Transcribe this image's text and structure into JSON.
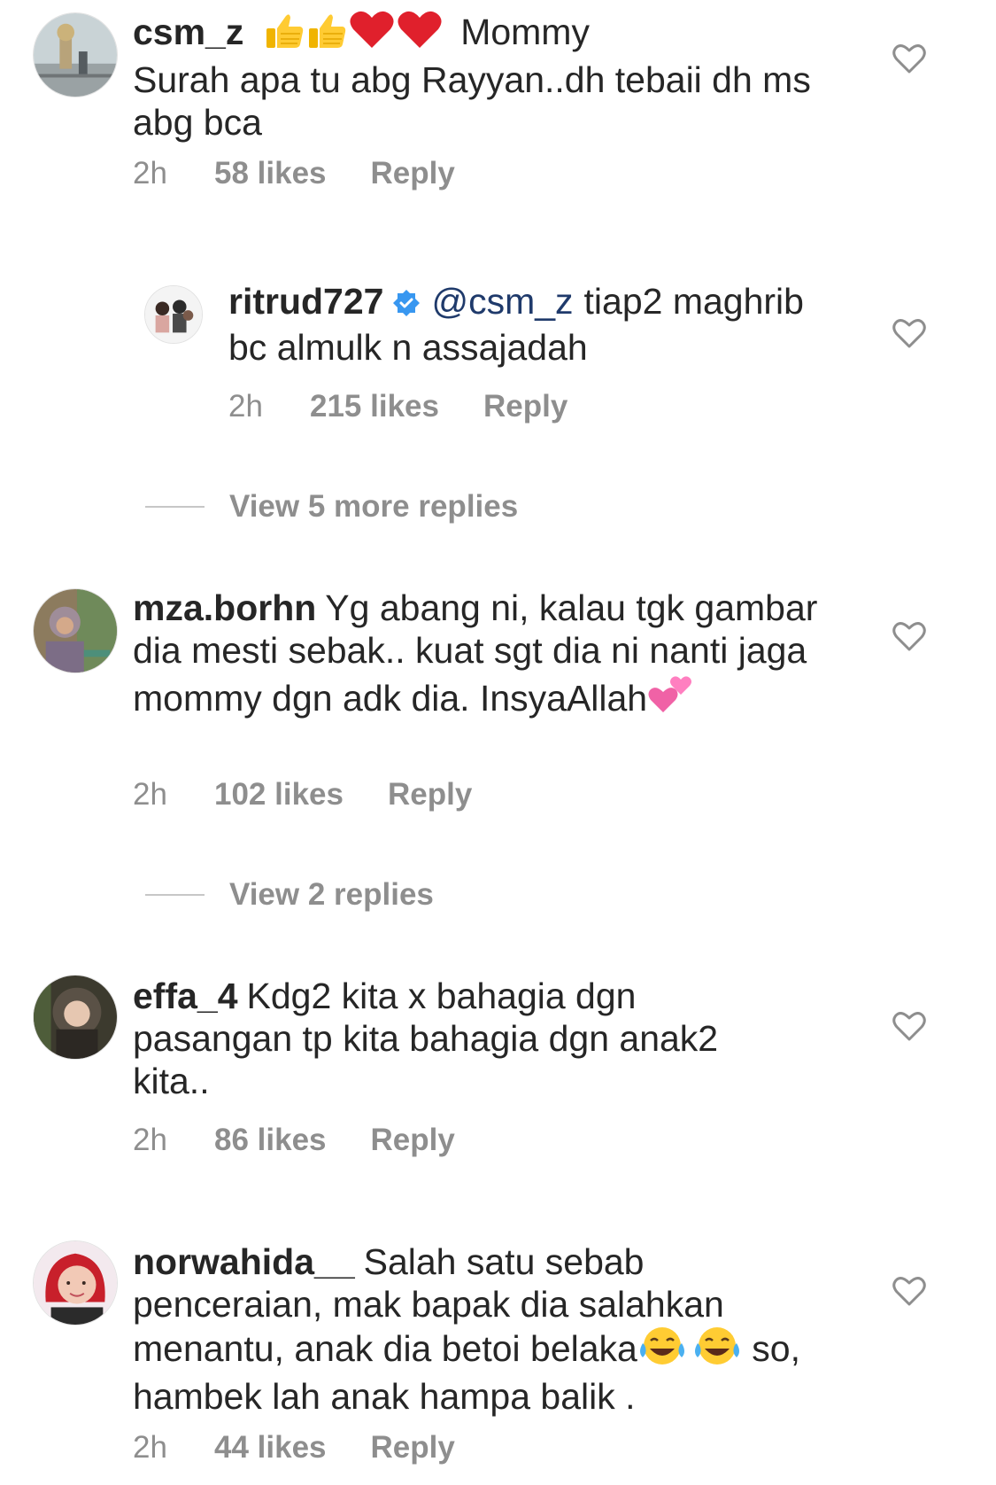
{
  "comments": [
    {
      "username": "csm_z",
      "emoji_prefix": [
        "thumbs-up",
        "thumbs-up",
        "red-heart",
        "red-heart"
      ],
      "text_line1": "Mommy",
      "text_rest": "Surah apa tu abg Rayyan..dh tebaii dh ms abg bca",
      "time": "2h",
      "likes": "58 likes",
      "reply": "Reply"
    },
    {
      "username": "ritrud727",
      "verified": true,
      "mention": "@csm_z",
      "text": "tiap2 maghrib bc almulk n assajadah",
      "time": "2h",
      "likes": "215 likes",
      "reply": "Reply"
    },
    {
      "username": "mza.borhn",
      "text": "Yg abang ni, kalau tgk gambar dia mesti sebak.. kuat sgt dia ni nanti jaga mommy dgn adk dia. InsyaAllah",
      "emoji_suffix": "two-hearts",
      "time": "2h",
      "likes": "102 likes",
      "reply": "Reply"
    },
    {
      "username": "effa_4",
      "text": "Kdg2 kita x bahagia dgn pasangan tp kita bahagia dgn anak2 kita..",
      "time": "2h",
      "likes": "86 likes",
      "reply": "Reply"
    },
    {
      "username": "norwahida__",
      "text_before": "Salah satu sebab penceraian, mak bapak dia salahkan menantu, anak dia betoi belaka",
      "emoji_mid": [
        "face-with-tears-of-joy",
        "face-with-tears-of-joy"
      ],
      "text_after": "so, hambek lah anak hampa balik .",
      "time": "2h",
      "likes": "44 likes",
      "reply": "Reply"
    }
  ],
  "view_replies": [
    {
      "label": "View 5 more replies"
    },
    {
      "label": "View 2 replies"
    }
  ],
  "colors": {
    "text": "#262626",
    "secondary": "#8e8e8e",
    "mention": "#1f3a6b",
    "verified": "#3897f0"
  }
}
